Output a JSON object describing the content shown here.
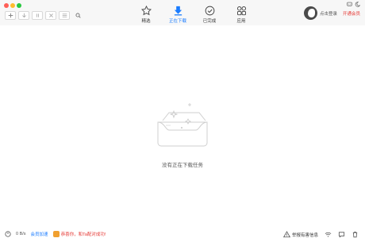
{
  "window": {
    "controls": [
      "close",
      "minimize",
      "maximize"
    ]
  },
  "toolbar": {
    "buttons": [
      {
        "icon": "plus-icon"
      },
      {
        "icon": "download-arrow-icon"
      },
      {
        "icon": "pause-icon"
      },
      {
        "icon": "delete-x-icon"
      },
      {
        "icon": "list-icon"
      },
      {
        "icon": "search-icon"
      }
    ]
  },
  "nav": {
    "items": [
      {
        "label": "精选",
        "icon": "star-icon"
      },
      {
        "label": "正在下载",
        "icon": "download-icon",
        "active": true
      },
      {
        "label": "已完成",
        "icon": "check-circle-icon"
      },
      {
        "label": "应用",
        "icon": "apps-grid-icon"
      }
    ]
  },
  "user": {
    "login": "点击登录",
    "vip": "开通会员"
  },
  "main": {
    "empty_message": "没有正在下载任务"
  },
  "status": {
    "speed": "0 B/s",
    "member_accel": "会员加速",
    "promo": "恭喜你，和Ta配对成功!",
    "report": "举报有害信息"
  },
  "colors": {
    "accent": "#1a7cff",
    "promo": "#e53935"
  }
}
